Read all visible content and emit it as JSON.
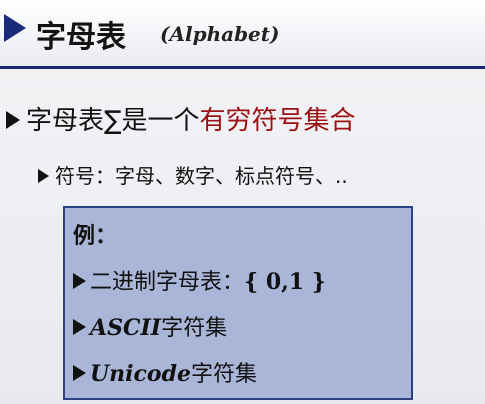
{
  "title": {
    "zh": "字母表",
    "en": "(Alphabet)"
  },
  "bullet1": {
    "prefix": "字母表∑是一个",
    "highlight": "有穷符号集合"
  },
  "bullet2": {
    "text": "符号：字母、数字、标点符号、.."
  },
  "example": {
    "heading": "例：",
    "items": [
      {
        "label": "二进制字母表：",
        "value": "{ 0,1 }"
      },
      {
        "latin": "ASCII",
        "cjk": "字符集"
      },
      {
        "latin": "Unicode",
        "cjk": "字符集"
      }
    ]
  },
  "colors": {
    "title_arrow": "#1a2a7a",
    "highlight": "#9b1010",
    "box_fill": "#aab6d8",
    "box_border": "#2e3f86"
  }
}
